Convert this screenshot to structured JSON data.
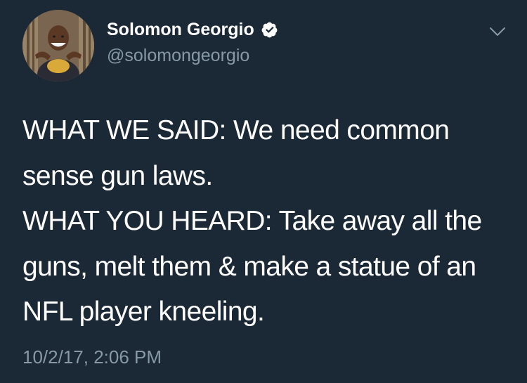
{
  "tweet": {
    "author": {
      "display_name": "Solomon Georgio",
      "handle": "@solomongeorgio",
      "verified": true,
      "avatar": "profile-photo"
    },
    "text_lines": [
      "WHAT WE SAID: We need common",
      "sense gun laws.",
      "WHAT YOU HEARD: Take away all the",
      "guns, melt them & make a statue of an",
      "NFL player kneeling."
    ],
    "timestamp": "10/2/17, 2:06 PM"
  },
  "icons": {
    "verified": "verified-badge-icon",
    "menu": "chevron-down-icon"
  },
  "colors": {
    "background": "#1b2836",
    "text_primary": "#ffffff",
    "text_secondary": "#8899a6"
  }
}
